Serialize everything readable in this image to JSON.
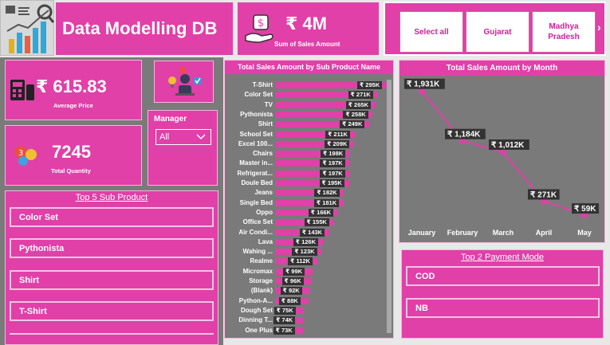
{
  "header": {
    "title": "Data Modelling DB",
    "sales_kpi_value": "₹ 4M",
    "sales_kpi_label": "Sum of Sales Amount"
  },
  "state_slicer": {
    "options": [
      "Select all",
      "Gujarat",
      "Madhya Pradesh"
    ],
    "next_arrow": "›"
  },
  "kpis": {
    "avg_price_value": "₹ 615.83",
    "avg_price_label": "Average Price",
    "quantity_value": "7245",
    "quantity_label": "Total Quantity"
  },
  "manager_filter": {
    "label": "Manager",
    "selected": "All"
  },
  "top5": {
    "title": "Top 5 Sub Product",
    "items": [
      "Color Set",
      "Pythonista",
      "Shirt",
      "T-Shirt"
    ]
  },
  "top2": {
    "title": "Top 2 Payment Mode",
    "items": [
      "COD",
      "NB"
    ]
  },
  "colors": {
    "accent": "#e040a8",
    "panel": "#7a7a7a",
    "label_bg": "#333333"
  },
  "chart_data": [
    {
      "type": "bar",
      "orientation": "horizontal",
      "title": "Total Sales Amount by Sub Product Name",
      "categories": [
        "T-Shirt",
        "Color Set",
        "TV",
        "Pythonista",
        "Shirt",
        "School Set",
        "Excel 100...",
        "Chairs",
        "Master in...",
        "Refrigerat...",
        "Doule Bed",
        "Jeans",
        "Single Bed",
        "Oppo",
        "Office Set",
        "Air Condi...",
        "Lava",
        "Wahing ...",
        "Realme",
        "Micromax",
        "Storage",
        "(Blank)",
        "Python-A...",
        "Dough Set",
        "Dinning T...",
        "One Plus"
      ],
      "values": [
        295,
        271,
        265,
        258,
        249,
        211,
        209,
        198,
        197,
        197,
        195,
        182,
        181,
        166,
        155,
        143,
        126,
        123,
        112,
        99,
        96,
        92,
        88,
        75,
        74,
        73
      ],
      "value_labels": [
        "₹ 295K",
        "₹ 271K",
        "₹ 265K",
        "₹ 258K",
        "₹ 249K",
        "₹ 211K",
        "₹ 209K",
        "₹ 198K",
        "₹ 197K",
        "₹ 197K",
        "₹ 195K",
        "₹ 182K",
        "₹ 181K",
        "₹ 166K",
        "₹ 155K",
        "₹ 143K",
        "₹ 126K",
        "₹ 123K",
        "₹ 112K",
        "₹ 99K",
        "₹ 96K",
        "₹ 92K",
        "₹ 88K",
        "₹ 75K",
        "₹ 74K",
        "₹ 73K"
      ],
      "unit": "K"
    },
    {
      "type": "line",
      "title": "Total Sales Amount by Month",
      "categories": [
        "January",
        "February",
        "March",
        "April",
        "May"
      ],
      "values": [
        1931,
        1184,
        1012,
        271,
        59
      ],
      "value_labels": [
        "₹ 1,931K",
        "₹ 1,184K",
        "₹ 1,012K",
        "₹ 271K",
        "₹ 59K"
      ],
      "unit": "K"
    }
  ]
}
